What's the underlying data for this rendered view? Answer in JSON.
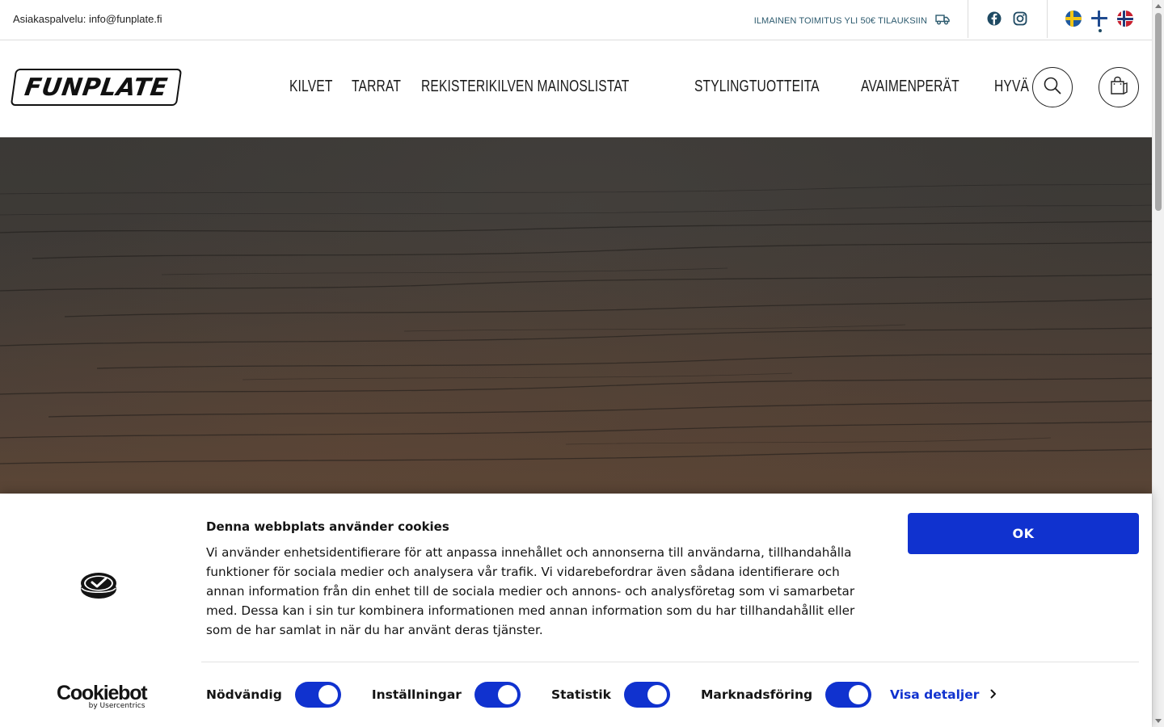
{
  "topbar": {
    "contact": "Asiakaspalvelu: info@funplate.fi",
    "shipping": "ILMAINEN TOIMITUS YLI 50€ TILAUKSIIN",
    "social_icons": [
      "facebook-icon",
      "instagram-icon"
    ],
    "languages": [
      {
        "code": "sv",
        "icon": "flag-sweden-icon"
      },
      {
        "code": "fi",
        "icon": "flag-finland-icon",
        "active": true
      },
      {
        "code": "no",
        "icon": "flag-norway-icon"
      }
    ]
  },
  "header": {
    "logo": "FUNPLATE",
    "nav": [
      {
        "label": "KILVET"
      },
      {
        "label": "TARRAT"
      },
      {
        "label": "REKISTERIKILVEN MAINOSLISTAT"
      },
      {
        "label": "STYLINGTUOTTEITA"
      },
      {
        "label": "AVAIMENPERÄT"
      },
      {
        "label": "HYVÄ OLLA"
      }
    ],
    "icons": [
      "search-icon",
      "shopping-bag-icon"
    ]
  },
  "cookie": {
    "title": "Denna webbplats använder cookies",
    "body": "Vi använder enhetsidentifierare för att anpassa innehållet och annonserna till användarna, tillhandahålla funktioner för sociala medier och analysera vår trafik. Vi vidarebefordrar även sådana identifierare och annan information från din enhet till de sociala medier och annons- och analysföretag som vi samarbetar med. Dessa kan i sin tur kombinera informationen med annan information som du har tillhandahållit eller som de har samlat in när du har använt deras tjänster.",
    "ok_label": "OK",
    "brand_name": "Cookiebot",
    "brand_by": "by Usercentrics",
    "toggles": [
      {
        "label": "Nödvändig",
        "on": true
      },
      {
        "label": "Inställningar",
        "on": true
      },
      {
        "label": "Statistik",
        "on": true
      },
      {
        "label": "Marknadsföring",
        "on": true
      }
    ],
    "details_label": "Visa detaljer"
  },
  "colors": {
    "accent": "#1032cf",
    "shipping_text": "#2c5a6e"
  }
}
